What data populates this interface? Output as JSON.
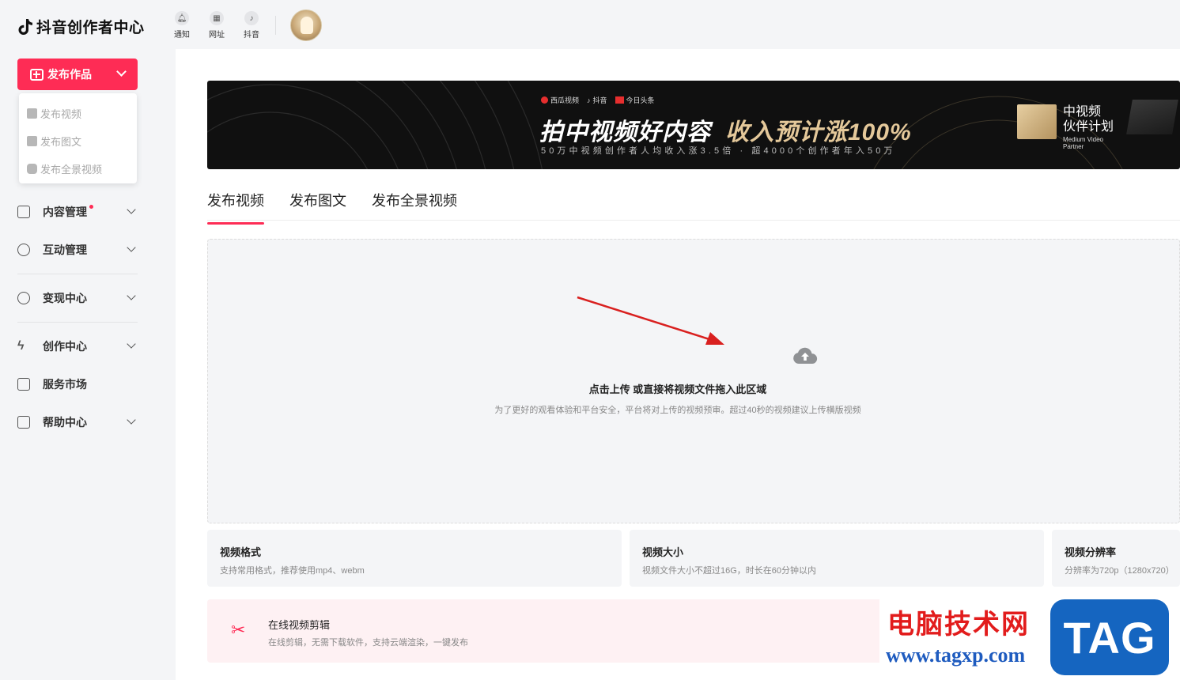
{
  "app": {
    "title": "抖音创作者中心"
  },
  "publish_button": {
    "label": "发布作品"
  },
  "publish_menu": [
    {
      "label": "发布视频"
    },
    {
      "label": "发布图文"
    },
    {
      "label": "发布全景视频"
    }
  ],
  "nav": [
    {
      "label": "内容管理"
    },
    {
      "label": "互动管理"
    },
    {
      "label": "变现中心"
    },
    {
      "label": "创作中心"
    },
    {
      "label": "服务市场"
    },
    {
      "label": "帮助中心"
    }
  ],
  "topbar": {
    "notify": "通知",
    "site": "网址",
    "douyin": "抖音"
  },
  "banner": {
    "brands": [
      "西瓜视频",
      "抖音",
      "今日头条"
    ],
    "headline_white": "拍中视频好内容",
    "headline_gold": "收入预计涨100%",
    "subline": "50万中视频创作者人均收入涨3.5倍 · 超4000个创作者年入50万",
    "plan_cn_1": "中视频",
    "plan_cn_2": "伙伴计划",
    "plan_en_1": "Medium Video",
    "plan_en_2": "Partner"
  },
  "tabs": [
    {
      "label": "发布视频"
    },
    {
      "label": "发布图文"
    },
    {
      "label": "发布全景视频"
    }
  ],
  "upload": {
    "title": "点击上传 或直接将视频文件拖入此区域",
    "hint": "为了更好的观看体验和平台安全，平台将对上传的视频预审。超过40秒的视频建议上传横版视频"
  },
  "info_cards": [
    {
      "title": "视频格式",
      "desc": "支持常用格式，推荐使用mp4、webm"
    },
    {
      "title": "视频大小",
      "desc": "视频文件大小不超过16G，时长在60分钟以内"
    },
    {
      "title": "视频分辨率",
      "desc": "分辨率为720p（1280x720）"
    }
  ],
  "online_edit": {
    "title": "在线视频剪辑",
    "desc": "在线剪辑，无需下载软件，支持云端渲染，一键发布"
  },
  "watermark": {
    "cn": "电脑技术网",
    "url": "www.tagxp.com",
    "tag": "TAG"
  },
  "colors": {
    "accent": "#fe2c55",
    "gold": "#e4c89a",
    "watermark_red": "#e21c1c",
    "watermark_blue": "#1565c0"
  }
}
